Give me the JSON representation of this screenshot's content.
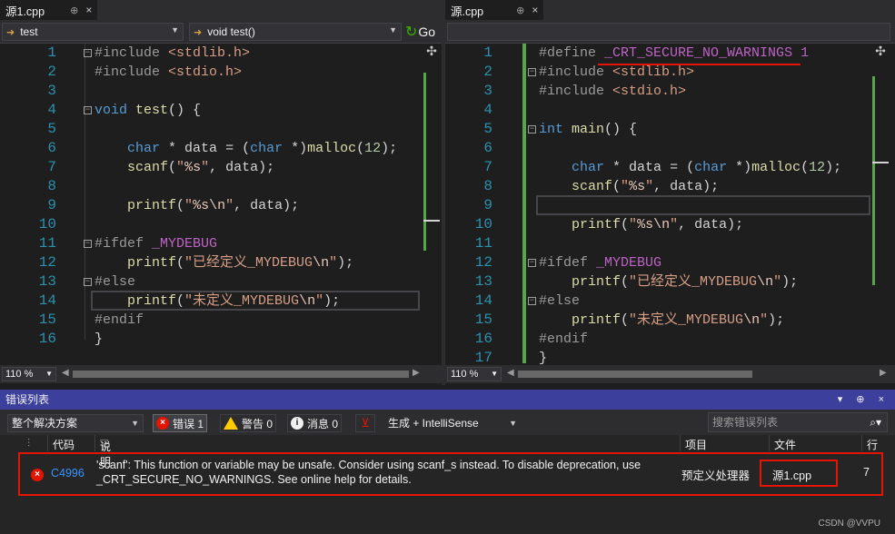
{
  "left_editor": {
    "tab": {
      "label": "源1.cpp",
      "pin": "⊕",
      "close": "×"
    },
    "nav": {
      "scope": "test",
      "function": "void test()",
      "go": "Go"
    },
    "zoom": "110 %",
    "lines": [
      {
        "n": "1",
        "code": "#include <stdlib.h>"
      },
      {
        "n": "2",
        "code": "#include <stdio.h>"
      },
      {
        "n": "3",
        "code": ""
      },
      {
        "n": "4",
        "code": "void test() {"
      },
      {
        "n": "5",
        "code": ""
      },
      {
        "n": "6",
        "code": "    char * data = (char *)malloc(12);"
      },
      {
        "n": "7",
        "code": "    scanf(\"%s\", data);"
      },
      {
        "n": "8",
        "code": ""
      },
      {
        "n": "9",
        "code": "    printf(\"%s\\n\", data);"
      },
      {
        "n": "10",
        "code": ""
      },
      {
        "n": "11",
        "code": "#ifdef _MYDEBUG"
      },
      {
        "n": "12",
        "code": "    printf(\"已经定义_MYDEBUG\\n\");"
      },
      {
        "n": "13",
        "code": "#else"
      },
      {
        "n": "14",
        "code": "    printf(\"未定义_MYDEBUG\\n\");"
      },
      {
        "n": "15",
        "code": "#endif"
      },
      {
        "n": "16",
        "code": "}"
      }
    ]
  },
  "right_editor": {
    "tab": {
      "label": "源.cpp",
      "pin": "⊕",
      "close": "×"
    },
    "zoom": "110 %",
    "lines": [
      {
        "n": "1",
        "code": "#define _CRT_SECURE_NO_WARNINGS 1"
      },
      {
        "n": "2",
        "code": "#include <stdlib.h>"
      },
      {
        "n": "3",
        "code": "#include <stdio.h>"
      },
      {
        "n": "4",
        "code": ""
      },
      {
        "n": "5",
        "code": "int main() {"
      },
      {
        "n": "6",
        "code": ""
      },
      {
        "n": "7",
        "code": "    char * data = (char *)malloc(12);"
      },
      {
        "n": "8",
        "code": "    scanf(\"%s\", data);"
      },
      {
        "n": "9",
        "code": ""
      },
      {
        "n": "10",
        "code": "    printf(\"%s\\n\", data);"
      },
      {
        "n": "11",
        "code": ""
      },
      {
        "n": "12",
        "code": "#ifdef _MYDEBUG"
      },
      {
        "n": "13",
        "code": "    printf(\"已经定义_MYDEBUG\\n\");"
      },
      {
        "n": "14",
        "code": "#else"
      },
      {
        "n": "15",
        "code": "    printf(\"未定义_MYDEBUG\\n\");"
      },
      {
        "n": "16",
        "code": "#endif"
      },
      {
        "n": "17",
        "code": "}"
      }
    ]
  },
  "error_list": {
    "title": "错误列表",
    "window_controls": "▾ ⊕ ×",
    "scope": "整个解决方案",
    "errors_btn": "错误 1",
    "warnings_btn": "警告 0",
    "messages_btn": "消息 0",
    "build_filter": "生成 + IntelliSense",
    "search_placeholder": "搜索错误列表",
    "columns": {
      "code": "代码",
      "description": "说明",
      "project": "项目",
      "file": "文件",
      "line": "行"
    },
    "rows": [
      {
        "code": "C4996",
        "description_1": "'scanf': This function or variable may be unsafe. Consider using scanf_s instead. To disable deprecation, use",
        "description_2": "_CRT_SECURE_NO_WARNINGS. See online help for details.",
        "project": "预定义处理器",
        "file": "源1.cpp",
        "line": "7"
      }
    ]
  },
  "watermark": "CSDN @VVPU",
  "colors": {
    "accent": "#3c3f9c",
    "error": "#e51400",
    "green_margin": "#57a64a"
  }
}
